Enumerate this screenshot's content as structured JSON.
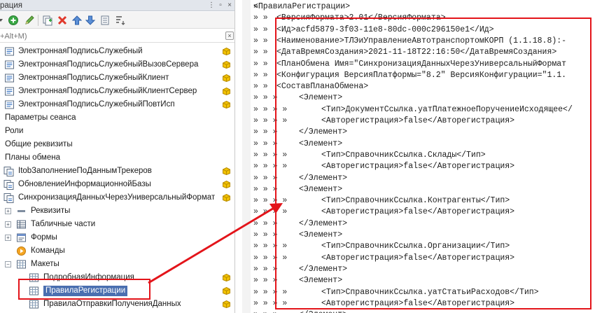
{
  "left_panel": {
    "title": "рация",
    "search_placeholder": "+Alt+M)",
    "toolbar_icons": [
      "menu-arrow-icon",
      "add-green-icon",
      "edit-pencil-icon",
      "copy-icon",
      "delete-icon",
      "move-up-icon",
      "move-down-icon",
      "list-icon",
      "sort-icon"
    ],
    "tree": [
      {
        "label": "ЭлектроннаяПодписьСлужебный",
        "icon": "module-icon",
        "cube": true
      },
      {
        "label": "ЭлектроннаяПодписьСлужебныйВызовСервера",
        "icon": "module-icon",
        "cube": true
      },
      {
        "label": "ЭлектроннаяПодписьСлужебныйКлиент",
        "icon": "module-icon",
        "cube": true
      },
      {
        "label": "ЭлектроннаяПодписьСлужебныйКлиентСервер",
        "icon": "module-icon",
        "cube": true
      },
      {
        "label": "ЭлектроннаяПодписьСлужебныйПовтИсп",
        "icon": "module-icon",
        "cube": true
      },
      {
        "label": "Параметры сеанса",
        "icon": "",
        "cube": false
      },
      {
        "label": "Роли",
        "icon": "",
        "cube": false
      },
      {
        "label": "Общие реквизиты",
        "icon": "",
        "cube": false
      },
      {
        "label": "Планы обмена",
        "icon": "",
        "cube": false
      },
      {
        "label": "ItobЗаполнениеПоДаннымТрекеров",
        "icon": "exchange-plan-icon",
        "cube": true
      },
      {
        "label": "ОбновлениеИнформационнойБазы",
        "icon": "exchange-plan-icon",
        "cube": true
      },
      {
        "label": "СинхронизацияДанныхЧерезУниверсальныйФормат",
        "icon": "exchange-plan-icon",
        "cube": true
      },
      {
        "label": "Реквизиты",
        "icon": "attributes-icon",
        "cube": false
      },
      {
        "label": "Табличные части",
        "icon": "table-icon",
        "cube": false
      },
      {
        "label": "Формы",
        "icon": "form-icon",
        "cube": false
      },
      {
        "label": "Команды",
        "icon": "command-icon",
        "cube": false
      },
      {
        "label": "Макеты",
        "icon": "template-icon",
        "cube": false
      },
      {
        "label": "ПодробнаяИнформация",
        "icon": "template-icon",
        "cube": true
      },
      {
        "label": "ПравилаРегистрации",
        "icon": "template-icon",
        "cube": true,
        "selected": true
      },
      {
        "label": "ПравилаОтправкиПолученияДанных",
        "icon": "template-icon",
        "cube": true
      }
    ]
  },
  "code_editor": {
    "lines": [
      {
        "depth": 0,
        "text": "<ПравилаРегистрации>"
      },
      {
        "depth": 1,
        "text": "<ВерсияФормата>2.01</ВерсияФормата>"
      },
      {
        "depth": 1,
        "text": "<Ид>acfd5879-3f03-11e8-80dc-000c296150e1</Ид>"
      },
      {
        "depth": 1,
        "text": "<Наименование>ТЛЭиУправлениеАвтотранспортомКОРП (1.1.18.8):-"
      },
      {
        "depth": 1,
        "text": "<ДатаВремяСоздания>2021-11-18T22:16:50</ДатаВремяСоздания>"
      },
      {
        "depth": 1,
        "text": "<ПланОбмена Имя=\"СинхронизацияДанныхЧерезУниверсальныйФормат"
      },
      {
        "depth": 1,
        "text": "<Конфигурация ВерсияПлатформы=\"8.2\" ВерсияКонфигурации=\"1.1."
      },
      {
        "depth": 1,
        "text": "<СоставПланаОбмена>"
      },
      {
        "depth": 2,
        "text": "<Элемент>"
      },
      {
        "depth": 3,
        "text": "<Тип>ДокументСсылка.уатПлатежноеПоручениеИсходящее</"
      },
      {
        "depth": 3,
        "text": "<Авторегистрация>false</Авторегистрация>"
      },
      {
        "depth": 2,
        "text": "</Элемент>"
      },
      {
        "depth": 2,
        "text": "<Элемент>"
      },
      {
        "depth": 3,
        "text": "<Тип>СправочникСсылка.Склады</Тип>"
      },
      {
        "depth": 3,
        "text": "<Авторегистрация>false</Авторегистрация>"
      },
      {
        "depth": 2,
        "text": "</Элемент>"
      },
      {
        "depth": 2,
        "text": "<Элемент>"
      },
      {
        "depth": 3,
        "text": "<Тип>СправочникСсылка.Контрагенты</Тип>"
      },
      {
        "depth": 3,
        "text": "<Авторегистрация>false</Авторегистрация>"
      },
      {
        "depth": 2,
        "text": "</Элемент>"
      },
      {
        "depth": 2,
        "text": "<Элемент>"
      },
      {
        "depth": 3,
        "text": "<Тип>СправочникСсылка.Организации</Тип>"
      },
      {
        "depth": 3,
        "text": "<Авторегистрация>false</Авторегистрация>"
      },
      {
        "depth": 2,
        "text": "</Элемент>"
      },
      {
        "depth": 2,
        "text": "<Элемент>"
      },
      {
        "depth": 3,
        "text": "<Тип>СправочникСсылка.уатСтатьиРасходов</Тип>"
      },
      {
        "depth": 3,
        "text": "<Авторегистрация>false</Авторегистрация>"
      },
      {
        "depth": 2,
        "text": "</Элемент>"
      }
    ]
  },
  "colors": {
    "annotation": "#e3141a",
    "selection": "#4a6fb0",
    "cube": "#f2c200"
  }
}
